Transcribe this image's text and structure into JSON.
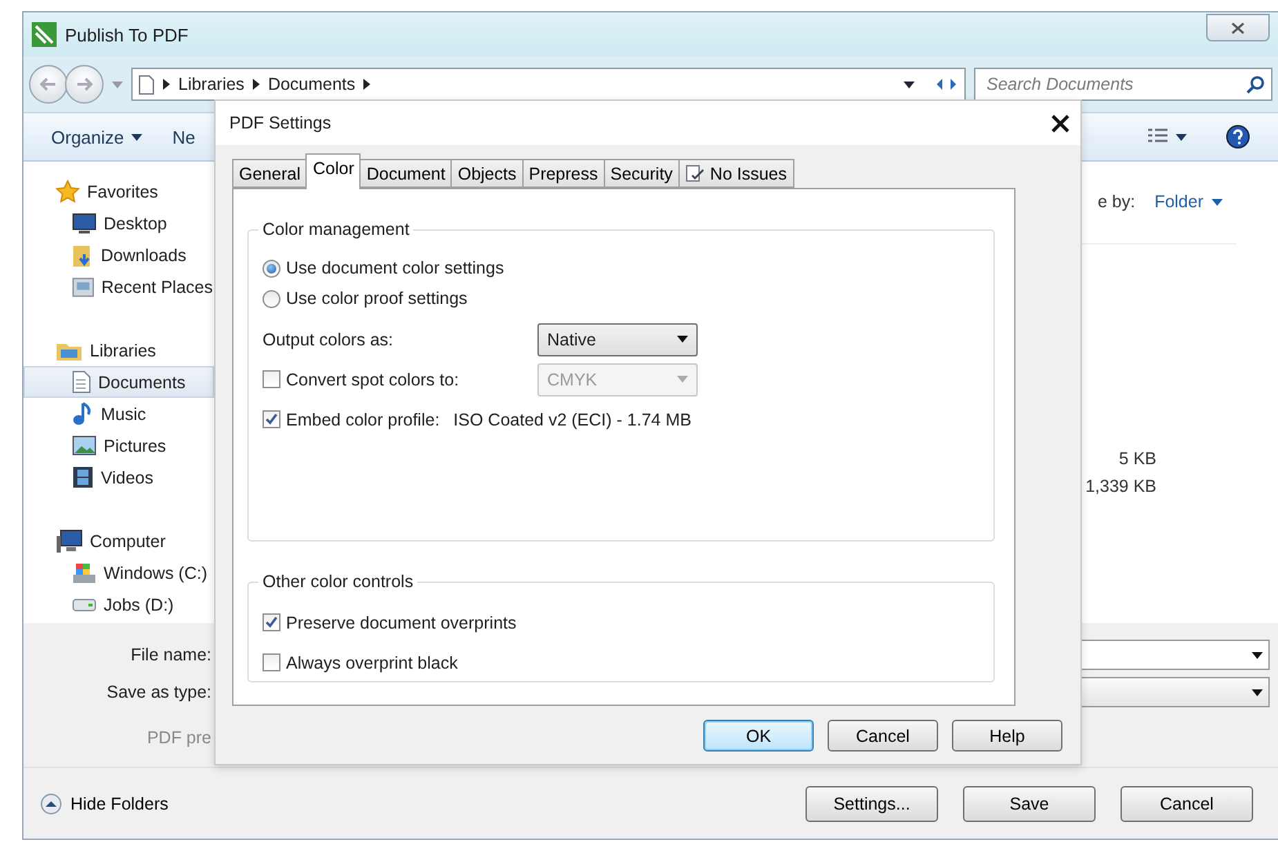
{
  "window": {
    "title": "Publish To PDF"
  },
  "address": {
    "crumbs": [
      "Libraries",
      "Documents"
    ],
    "search_placeholder": "Search Documents"
  },
  "toolbar": {
    "organize": "Organize",
    "new_folder": "Ne"
  },
  "sidebar": {
    "groups": [
      {
        "label": "Favorites",
        "selected": false,
        "children": [
          {
            "label": "Desktop",
            "selected": false
          },
          {
            "label": "Downloads",
            "selected": false
          },
          {
            "label": "Recent Places",
            "selected": false
          }
        ]
      },
      {
        "label": "Libraries",
        "selected": false,
        "children": [
          {
            "label": "Documents",
            "selected": true
          },
          {
            "label": "Music",
            "selected": false
          },
          {
            "label": "Pictures",
            "selected": false
          },
          {
            "label": "Videos",
            "selected": false
          }
        ]
      },
      {
        "label": "Computer",
        "selected": false,
        "children": [
          {
            "label": "Windows (C:)",
            "selected": false
          },
          {
            "label": "Jobs (D:)",
            "selected": false
          }
        ]
      }
    ]
  },
  "arrange": {
    "label": "e by:",
    "value": "Folder"
  },
  "files": {
    "sizes": [
      "5 KB",
      "1,339 KB"
    ]
  },
  "form": {
    "file_name_label": "File name:",
    "save_type_label": "Save as type:",
    "preset_label": "PDF pre"
  },
  "footer": {
    "hide_folders": "Hide Folders",
    "buttons": [
      "Settings...",
      "Save",
      "Cancel"
    ]
  },
  "dialog": {
    "title": "PDF Settings",
    "tabs": [
      {
        "label": "General",
        "selected": false
      },
      {
        "label": "Color",
        "selected": true
      },
      {
        "label": "Document",
        "selected": false
      },
      {
        "label": "Objects",
        "selected": false
      },
      {
        "label": "Prepress",
        "selected": false
      },
      {
        "label": "Security",
        "selected": false
      },
      {
        "label": "No Issues",
        "selected": false,
        "kind": "status"
      }
    ],
    "color_management": {
      "title": "Color management",
      "options": [
        {
          "label": "Use document color settings",
          "selected": true
        },
        {
          "label": "Use color proof settings",
          "selected": false
        }
      ],
      "output": {
        "label": "Output colors as:",
        "value": "Native",
        "disabled": false
      },
      "convert": {
        "label": "Convert spot colors to:",
        "checked": false,
        "value": "CMYK",
        "disabled": true
      },
      "embed": {
        "label": "Embed color profile:",
        "checked": true,
        "profile": "ISO Coated v2 (ECI) - 1.74 MB"
      }
    },
    "other": {
      "title": "Other color controls",
      "items": [
        {
          "label": "Preserve document overprints",
          "checked": true
        },
        {
          "label": "Always overprint black",
          "checked": false
        }
      ]
    },
    "buttons": [
      {
        "label": "OK",
        "default": true
      },
      {
        "label": "Cancel",
        "default": false
      },
      {
        "label": "Help",
        "default": false
      }
    ]
  }
}
